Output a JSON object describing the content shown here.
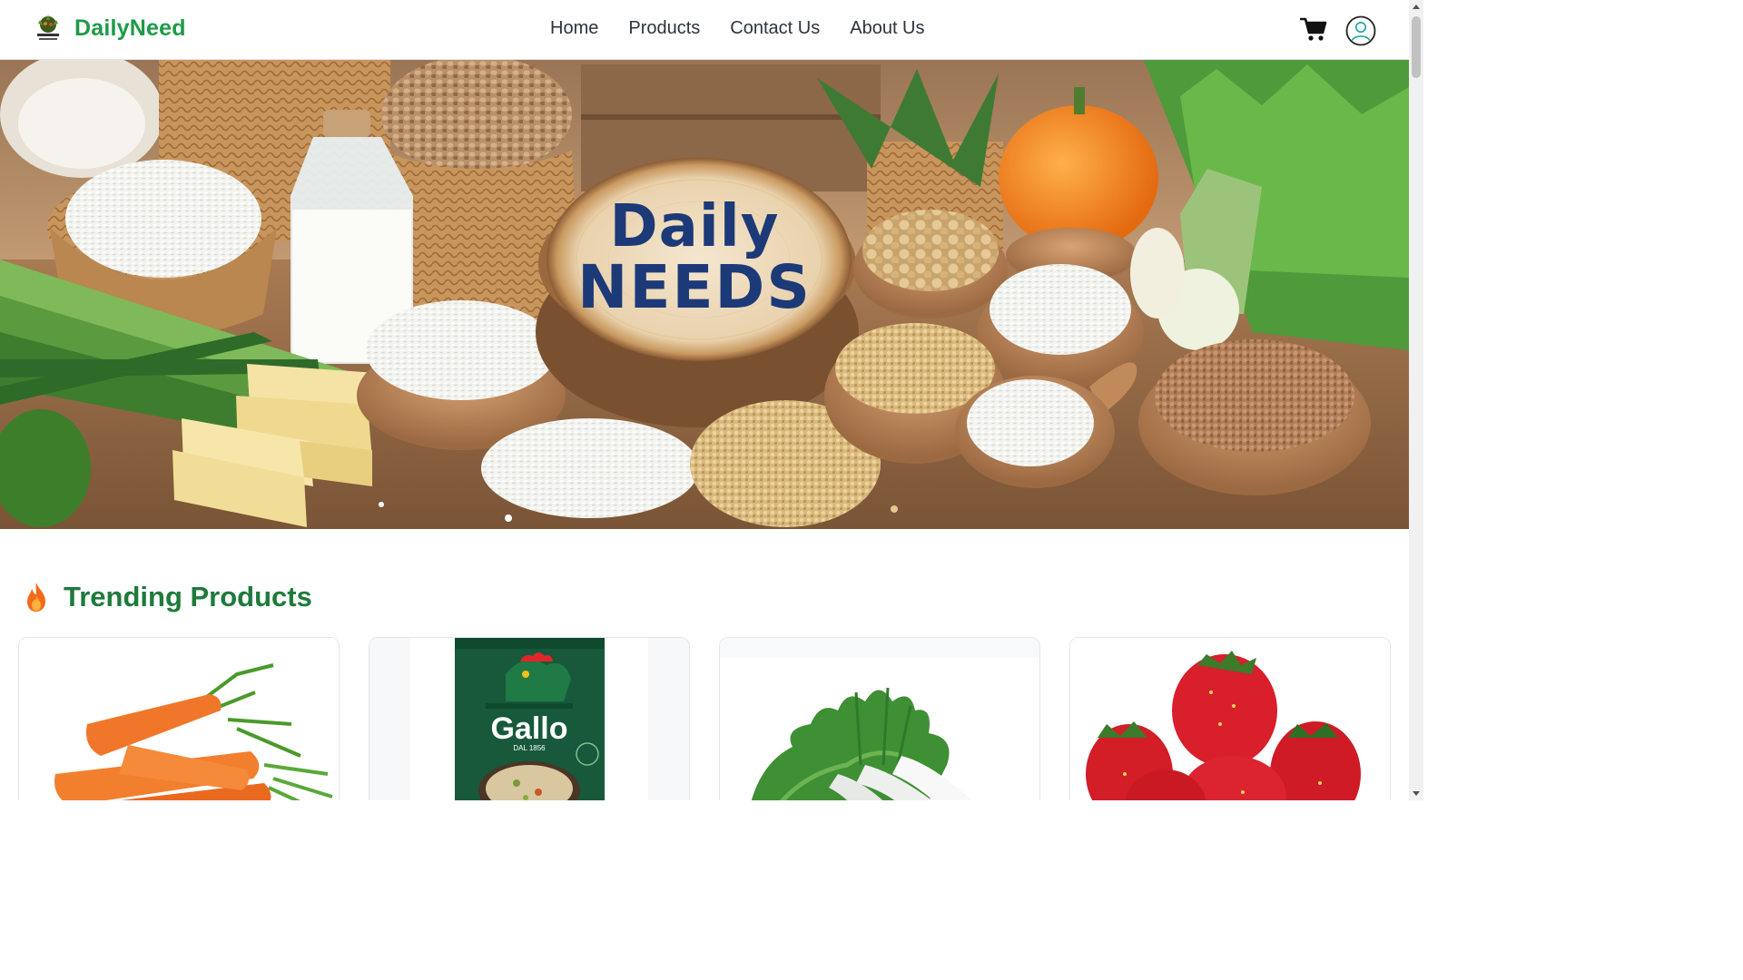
{
  "brand": {
    "name": "DailyNeed",
    "logo_icon": "daily-need-logo-icon"
  },
  "nav": {
    "items": [
      {
        "label": "Home"
      },
      {
        "label": "Products"
      },
      {
        "label": "Contact Us"
      },
      {
        "label": "About Us"
      }
    ]
  },
  "header_actions": {
    "cart_icon": "cart-icon",
    "profile_icon": "user-circle-icon"
  },
  "hero": {
    "line1": "Daily",
    "line2": "NEEDS"
  },
  "trending": {
    "title": "Trending Products",
    "icon": "fire-icon",
    "products": [
      {
        "image": "carrots"
      },
      {
        "image": "gallo-rice-box",
        "brand_text": "Gallo",
        "brand_subtext": "DAL 1856"
      },
      {
        "image": "white-radish"
      },
      {
        "image": "strawberries"
      }
    ]
  },
  "colors": {
    "brand_green": "#1e9a47",
    "heading_green": "#1e7a3c",
    "nav_text": "#2c3340",
    "hero_text": "#1d3a78"
  }
}
